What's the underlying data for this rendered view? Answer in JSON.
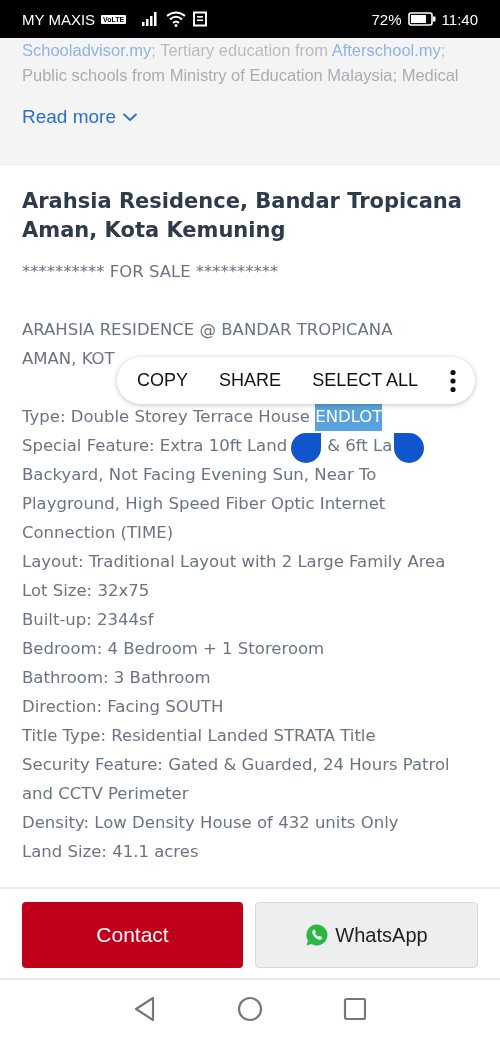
{
  "status_bar": {
    "carrier": "MY MAXIS",
    "volte": "VoLTE",
    "battery": "72%",
    "time": "11:40"
  },
  "about": {
    "lines": [
      {
        "faded": false,
        "segments": [
          {
            "kind": "link",
            "text": "Schooladvisor.my"
          },
          {
            "kind": "text",
            "text": "; Tertiary education from "
          },
          {
            "kind": "link",
            "text": "Afterschool.my"
          },
          {
            "kind": "text",
            "text": ";"
          }
        ]
      },
      {
        "faded": true,
        "segments": [
          {
            "kind": "text",
            "text": "Public schools from Ministry of Education Malaysia; Medical"
          }
        ]
      }
    ],
    "read_more": "Read more"
  },
  "listing": {
    "title": "Arahsia Residence, Bandar Tropicana Aman, Kota Kemuning",
    "paragraphs": [
      [
        {
          "segments": [
            {
              "kind": "text",
              "text": "********** FOR SALE **********",
              "selected": false
            }
          ]
        }
      ],
      [
        {
          "segments": [
            {
              "kind": "text",
              "text": "ARAHSIA RESIDENCE @ BANDAR TROPICANA",
              "selected": false
            }
          ]
        },
        {
          "segments": [
            {
              "kind": "text",
              "text": "AMAN, KOT",
              "selected": false
            }
          ]
        }
      ],
      [
        {
          "segments": [
            {
              "kind": "text",
              "text": "Type: Double Storey Terrace House ",
              "selected": false
            },
            {
              "kind": "text",
              "text": "ENDLOT",
              "selected": true
            }
          ]
        },
        {
          "segments": [
            {
              "kind": "text",
              "text": "Special Feature: Extra 10ft Land",
              "selected": false
            },
            {
              "kind": "left_handle"
            },
            {
              "kind": "text",
              "text": "& 6ft La",
              "selected": false
            },
            {
              "kind": "right_handle"
            }
          ]
        },
        {
          "segments": [
            {
              "kind": "text",
              "text": "Backyard, Not Facing Evening Sun, Near To",
              "selected": false
            }
          ]
        },
        {
          "segments": [
            {
              "kind": "text",
              "text": "Playground, High Speed Fiber Optic Internet",
              "selected": false
            }
          ]
        },
        {
          "segments": [
            {
              "kind": "text",
              "text": "Connection (TIME)",
              "selected": false
            }
          ]
        },
        {
          "segments": [
            {
              "kind": "text",
              "text": "Layout: Traditional Layout with 2 Large Family Area",
              "selected": false
            }
          ]
        },
        {
          "segments": [
            {
              "kind": "text",
              "text": "Lot Size: 32x75",
              "selected": false
            }
          ]
        },
        {
          "segments": [
            {
              "kind": "text",
              "text": "Built-up: 2344sf",
              "selected": false
            }
          ]
        },
        {
          "segments": [
            {
              "kind": "text",
              "text": "Bedroom: 4 Bedroom + 1 Storeroom",
              "selected": false
            }
          ]
        },
        {
          "segments": [
            {
              "kind": "text",
              "text": "Bathroom: 3 Bathroom",
              "selected": false
            }
          ]
        },
        {
          "segments": [
            {
              "kind": "text",
              "text": "Direction: Facing SOUTH",
              "selected": false
            }
          ]
        },
        {
          "segments": [
            {
              "kind": "text",
              "text": "Title Type: Residential Landed STRATA Title",
              "selected": false
            }
          ]
        },
        {
          "segments": [
            {
              "kind": "text",
              "text": "Security Feature: Gated & Guarded, 24 Hours Patrol",
              "selected": false
            }
          ]
        },
        {
          "segments": [
            {
              "kind": "text",
              "text": "and CCTV Perimeter",
              "selected": false
            }
          ]
        },
        {
          "segments": [
            {
              "kind": "text",
              "text": "Density: Low Density House of 432 units Only",
              "selected": false
            }
          ]
        },
        {
          "segments": [
            {
              "kind": "text",
              "text": "Land Size: 41.1 acres",
              "selected": false
            }
          ]
        }
      ]
    ]
  },
  "selection_menu": {
    "items": [
      "COPY",
      "SHARE",
      "SELECT ALL"
    ]
  },
  "actions": [
    {
      "kind": "contact",
      "label": "Contact"
    },
    {
      "kind": "whatsapp",
      "label": "WhatsApp"
    }
  ]
}
